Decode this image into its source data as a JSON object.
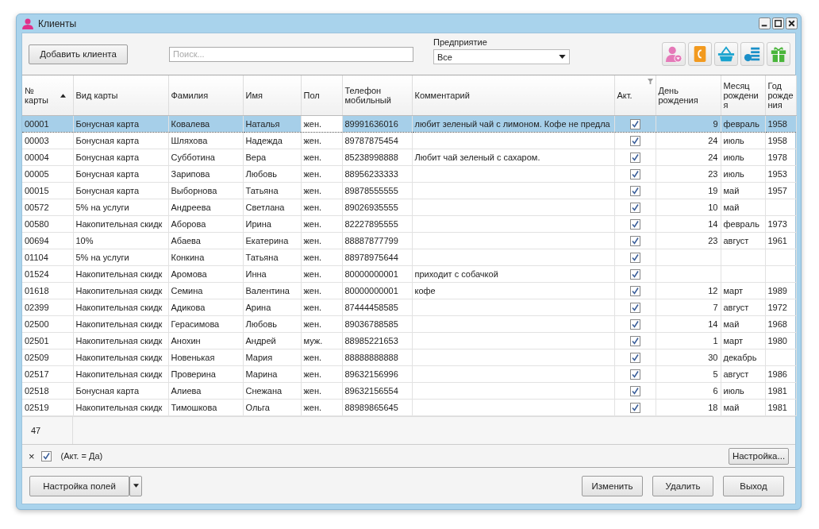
{
  "window": {
    "title": "Клиенты"
  },
  "toolbar": {
    "add_button": "Добавить клиента",
    "search": {
      "placeholder": "Поиск..."
    },
    "company": {
      "label": "Предприятие",
      "value": "Все"
    }
  },
  "table": {
    "columns": [
      {
        "label": "№ карты",
        "sorted": true,
        "filtered": false,
        "focused": false
      },
      {
        "label": "Вид карты",
        "sorted": false,
        "filtered": false,
        "focused": false
      },
      {
        "label": "Фамилия",
        "sorted": false,
        "filtered": false,
        "focused": false
      },
      {
        "label": "Имя",
        "sorted": false,
        "filtered": false,
        "focused": false
      },
      {
        "label": "Пол",
        "sorted": false,
        "filtered": false,
        "focused": true
      },
      {
        "label": "Телефон мобильный",
        "sorted": false,
        "filtered": false,
        "focused": false
      },
      {
        "label": "Комментарий",
        "sorted": false,
        "filtered": false,
        "focused": false
      },
      {
        "label": "Акт.",
        "sorted": false,
        "filtered": true,
        "focused": false
      },
      {
        "label": "День рождения",
        "sorted": false,
        "filtered": false,
        "focused": false
      },
      {
        "label": "Месяц рождения",
        "sorted": false,
        "filtered": false,
        "focused": false
      },
      {
        "label": "Год рождения",
        "sorted": false,
        "filtered": false,
        "focused": false
      }
    ],
    "rows": [
      {
        "selected": true,
        "cells": [
          "00001",
          "Бонусная карта",
          "Ковалева",
          "Наталья",
          "жен.",
          "89991636016",
          "любит зеленый чай с лимоном. Кофе не предла",
          true,
          "9",
          "февраль",
          "1958"
        ]
      },
      {
        "selected": false,
        "cells": [
          "00003",
          "Бонусная карта",
          "Шляхова",
          "Надежда",
          "жен.",
          "89787875454",
          "",
          true,
          "24",
          "июль",
          "1958"
        ]
      },
      {
        "selected": false,
        "cells": [
          "00004",
          "Бонусная карта",
          "Субботина",
          "Вера",
          "жен.",
          "85238998888",
          "Любит чай зеленый с сахаром.",
          true,
          "24",
          "июль",
          "1978"
        ]
      },
      {
        "selected": false,
        "cells": [
          "00005",
          "Бонусная карта",
          "Зарипова",
          "Любовь",
          "жен.",
          "88956233333",
          "",
          true,
          "23",
          "июль",
          "1953"
        ]
      },
      {
        "selected": false,
        "cells": [
          "00015",
          "Бонусная карта",
          "Выборнова",
          "Татьяна",
          "жен.",
          "89878555555",
          "",
          true,
          "19",
          "май",
          "1957"
        ]
      },
      {
        "selected": false,
        "cells": [
          "00572",
          "5% на услуги",
          "Андреева",
          "Светлана",
          "жен.",
          "89026935555",
          "",
          true,
          "10",
          "май",
          ""
        ]
      },
      {
        "selected": false,
        "cells": [
          "00580",
          "Накопительная скидк",
          "Аборова",
          "Ирина",
          "жен.",
          "82227895555",
          "",
          true,
          "14",
          "февраль",
          "1973"
        ]
      },
      {
        "selected": false,
        "cells": [
          "00694",
          "10%",
          "Абаева",
          "Екатерина",
          "жен.",
          "88887877799",
          "",
          true,
          "23",
          "август",
          "1961"
        ]
      },
      {
        "selected": false,
        "cells": [
          "01104",
          "5% на услуги",
          "Конкина",
          "Татьяна",
          "жен.",
          "88978975644",
          "",
          true,
          "",
          "",
          ""
        ]
      },
      {
        "selected": false,
        "cells": [
          "01524",
          "Накопительная скидк",
          "Аромова",
          "Инна",
          "жен.",
          "80000000001",
          "приходит с собачкой",
          true,
          "",
          "",
          ""
        ]
      },
      {
        "selected": false,
        "cells": [
          "01618",
          "Накопительная скидк",
          "Семина",
          "Валентина",
          "жен.",
          "80000000001",
          "кофе",
          true,
          "12",
          "март",
          "1989"
        ]
      },
      {
        "selected": false,
        "cells": [
          "02399",
          "Накопительная скидк",
          "Адикова",
          "Арина",
          "жен.",
          "87444458585",
          "",
          true,
          "7",
          "август",
          "1972"
        ]
      },
      {
        "selected": false,
        "cells": [
          "02500",
          "Накопительная скидк",
          "Герасимова",
          "Любовь",
          "жен.",
          "89036788585",
          "",
          true,
          "14",
          "май",
          "1968"
        ]
      },
      {
        "selected": false,
        "cells": [
          "02501",
          "Накопительная скидк",
          "Анохин",
          "Андрей",
          "муж.",
          "88985221653",
          "",
          true,
          "1",
          "март",
          "1980"
        ]
      },
      {
        "selected": false,
        "cells": [
          "02509",
          "Накопительная скидк",
          "Новенькая",
          "Мария",
          "жен.",
          "88888888888",
          "",
          true,
          "30",
          "декабрь",
          ""
        ]
      },
      {
        "selected": false,
        "cells": [
          "02517",
          "Накопительная скидк",
          "Проверина",
          "Марина",
          "жен.",
          "89632156996",
          "",
          true,
          "5",
          "август",
          "1986"
        ]
      },
      {
        "selected": false,
        "cells": [
          "02518",
          "Бонусная карта",
          "Алиева",
          "Снежана",
          "жен.",
          "89632156554",
          "",
          true,
          "6",
          "июль",
          "1981"
        ]
      },
      {
        "selected": false,
        "cells": [
          "02519",
          "Накопительная скидк",
          "Тимошкова",
          "Ольга",
          "жен.",
          "88989865645",
          "",
          true,
          "18",
          "май",
          "1981"
        ]
      }
    ],
    "total": "47"
  },
  "filter_bar": {
    "clear": "×",
    "enabled": true,
    "expression": "(Акт. = Да)",
    "settings_button": "Настройка..."
  },
  "buttons": {
    "fields": "Настройка полей",
    "edit": "Изменить",
    "delete": "Удалить",
    "exit": "Выход"
  }
}
